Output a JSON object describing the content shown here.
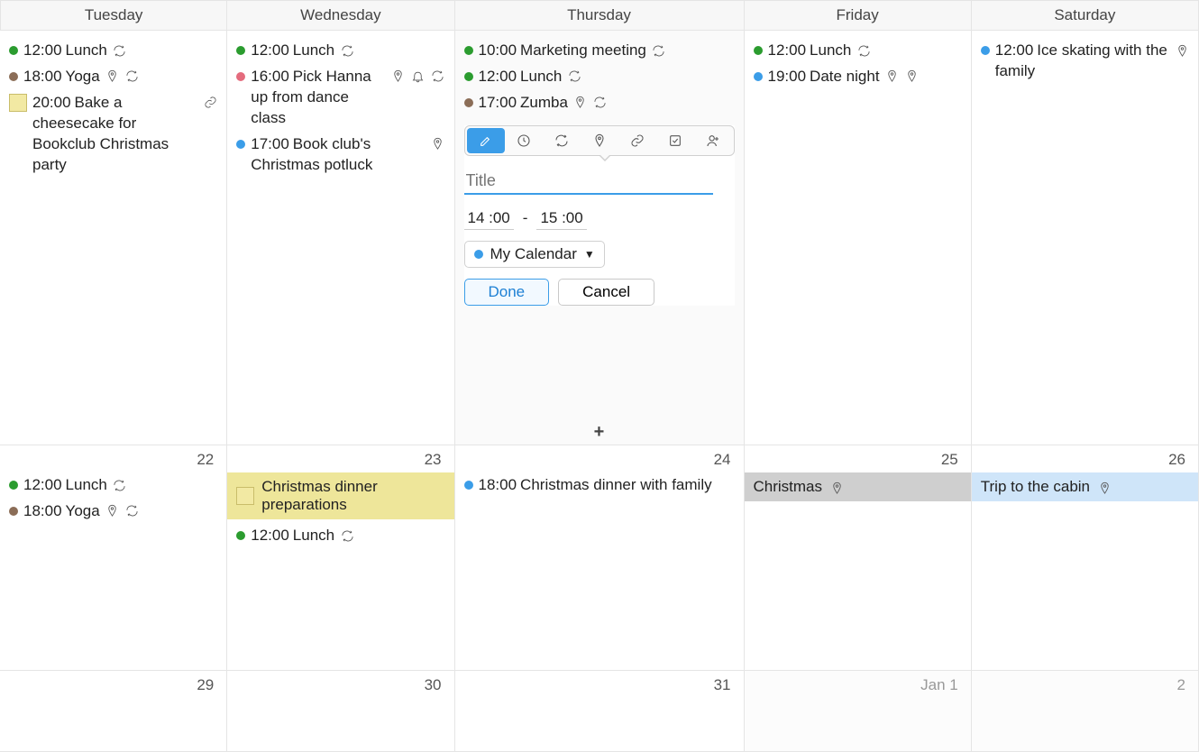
{
  "headers": [
    "Tuesday",
    "Wednesday",
    "Thursday",
    "Friday",
    "Saturday"
  ],
  "week1": {
    "tue": {
      "evts": [
        {
          "color": "green",
          "time": "12:00",
          "title": "Lunch",
          "icons": [
            "repeat"
          ]
        },
        {
          "color": "brown",
          "time": "18:00",
          "title": "Yoga",
          "icons": [
            "pin",
            "repeat"
          ]
        },
        {
          "square": true,
          "time": "20:00",
          "title": "Bake a cheesecake for Bookclub Christmas party",
          "icons": [
            "link"
          ]
        }
      ]
    },
    "wed": {
      "evts": [
        {
          "color": "green",
          "time": "12:00",
          "title": "Lunch",
          "icons": [
            "repeat"
          ]
        },
        {
          "color": "pink",
          "time": "16:00",
          "title": "Pick Hanna up from dance class",
          "icons": [
            "pin",
            "bell",
            "repeat"
          ]
        },
        {
          "color": "blue",
          "time": "17:00",
          "title": "Book club's Christmas potluck",
          "icons": [
            "pin"
          ]
        }
      ]
    },
    "thu": {
      "evts": [
        {
          "color": "green",
          "time": "10:00",
          "title": "Marketing meeting",
          "icons": [
            "repeat"
          ]
        },
        {
          "color": "green",
          "time": "12:00",
          "title": "Lunch",
          "icons": [
            "repeat"
          ]
        },
        {
          "color": "brown",
          "time": "17:00",
          "title": "Zumba",
          "icons": [
            "pin",
            "repeat"
          ]
        }
      ],
      "popup": {
        "title_placeholder": "Title",
        "start": "14:00",
        "sep": "-",
        "end": "15:00",
        "calendar": "My Calendar",
        "done": "Done",
        "cancel": "Cancel"
      }
    },
    "fri": {
      "evts": [
        {
          "color": "green",
          "time": "12:00",
          "title": "Lunch",
          "icons": [
            "repeat"
          ]
        },
        {
          "color": "blue",
          "time": "19:00",
          "title": "Date night",
          "icons": [
            "pin-blank",
            "pin"
          ]
        }
      ]
    },
    "sat": {
      "evts": [
        {
          "color": "blue",
          "time": "12:00",
          "title": "Ice skating with the family",
          "icons": [
            "pin"
          ]
        }
      ]
    }
  },
  "week2": {
    "tue": {
      "num": "22",
      "evts": [
        {
          "color": "green",
          "time": "12:00",
          "title": "Lunch",
          "icons": [
            "repeat"
          ]
        },
        {
          "color": "brown",
          "time": "18:00",
          "title": "Yoga",
          "icons": [
            "pin",
            "repeat"
          ]
        }
      ]
    },
    "wed": {
      "num": "23",
      "banner": {
        "type": "yellow",
        "withsq": true,
        "title": "Christmas dinner preparations"
      },
      "evts": [
        {
          "color": "green",
          "time": "12:00",
          "title": "Lunch",
          "icons": [
            "repeat"
          ]
        }
      ]
    },
    "thu": {
      "num": "24",
      "evts": [
        {
          "color": "blue",
          "time": "18:00",
          "title": "Christmas dinner with family"
        }
      ]
    },
    "fri": {
      "num": "25",
      "banner": {
        "type": "gray",
        "title": "Christmas",
        "icons": [
          "pin"
        ]
      }
    },
    "sat": {
      "num": "26",
      "banner": {
        "type": "lblue",
        "title": "Trip to the cabin",
        "icons": [
          "pin"
        ]
      }
    }
  },
  "week3": {
    "tue": {
      "num": "29"
    },
    "wed": {
      "num": "30"
    },
    "thu": {
      "num": "31"
    },
    "fri": {
      "num": "Jan  1"
    },
    "sat": {
      "num": "2"
    }
  }
}
